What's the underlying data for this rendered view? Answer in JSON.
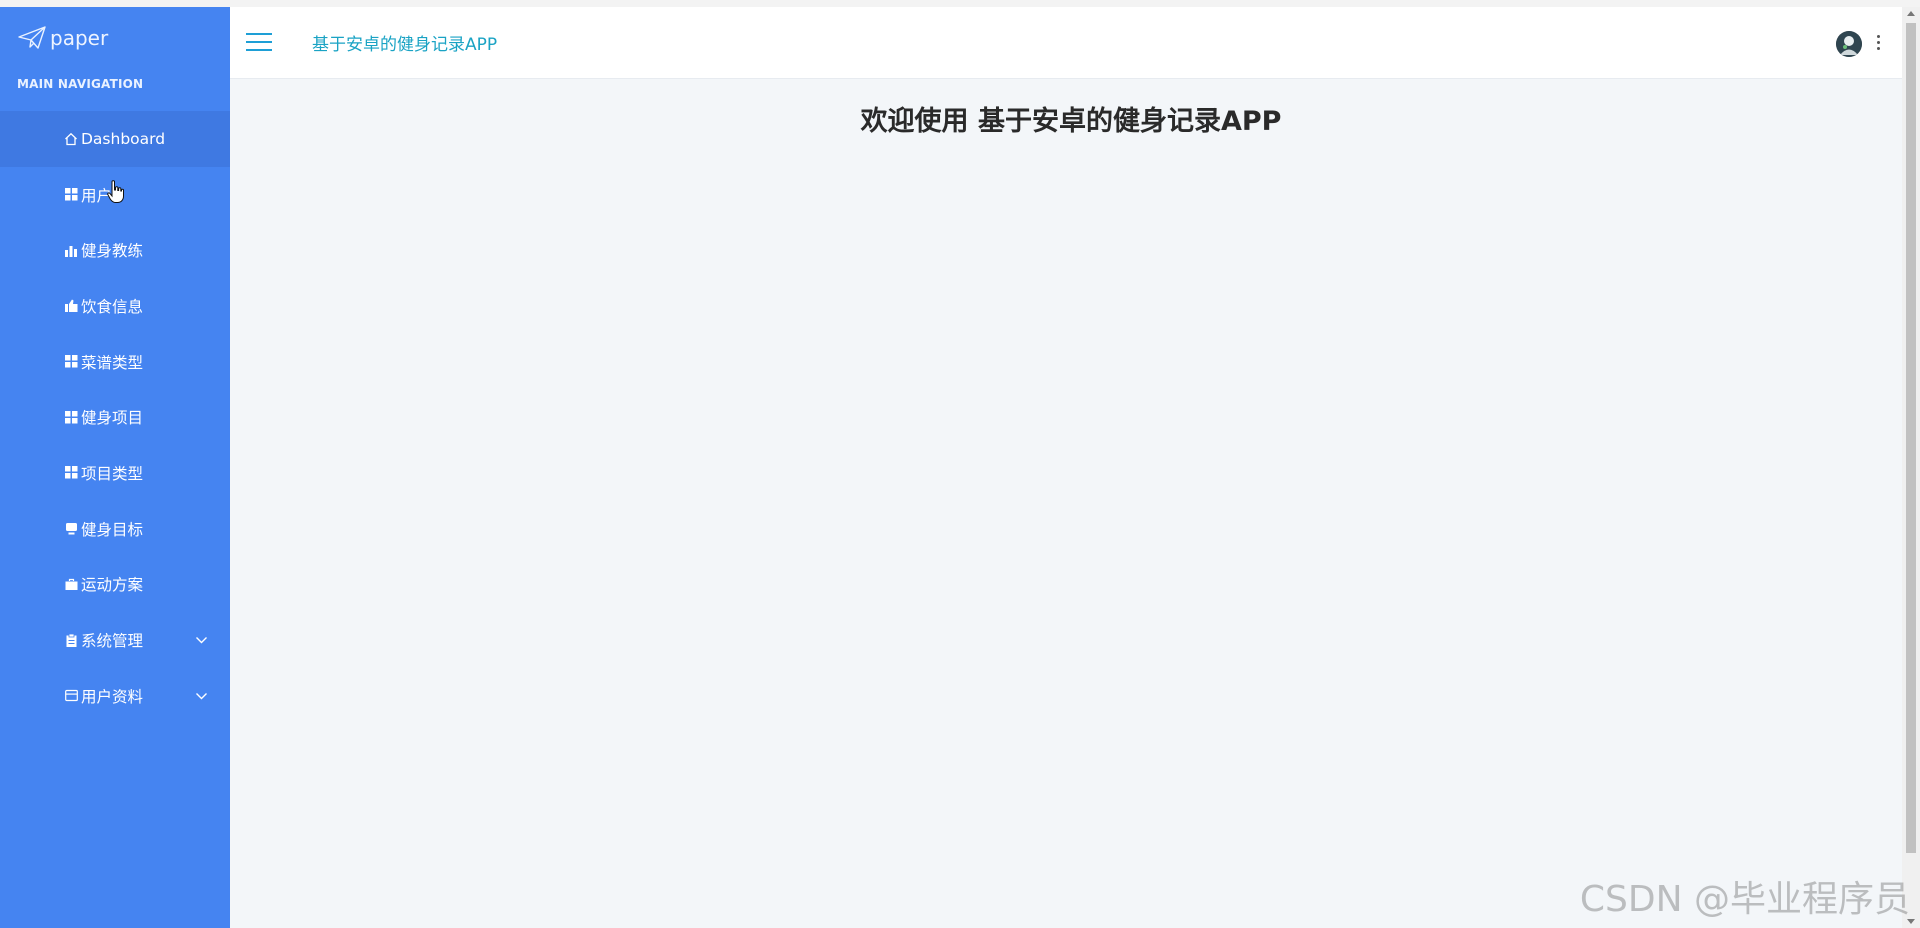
{
  "brand": {
    "logo_text": "paper"
  },
  "sidebar": {
    "heading": "MAIN NAVIGATION",
    "items": [
      {
        "label": "Dashboard",
        "icon": "home-icon"
      },
      {
        "label": "用户",
        "icon": "grid-icon"
      },
      {
        "label": "健身教练",
        "icon": "bar-chart-icon"
      },
      {
        "label": "饮食信息",
        "icon": "thumbs-up-icon"
      },
      {
        "label": "菜谱类型",
        "icon": "grid-icon"
      },
      {
        "label": "健身项目",
        "icon": "grid-icon"
      },
      {
        "label": "项目类型",
        "icon": "grid-icon"
      },
      {
        "label": "健身目标",
        "icon": "monitor-icon"
      },
      {
        "label": "运动方案",
        "icon": "briefcase-icon"
      },
      {
        "label": "系统管理",
        "icon": "clipboard-icon"
      },
      {
        "label": "用户资料",
        "icon": "id-card-icon"
      }
    ]
  },
  "header": {
    "app_title": "基于安卓的健身记录APP"
  },
  "main": {
    "welcome": "欢迎使用 基于安卓的健身记录APP"
  },
  "watermark": "CSDN @毕业程序员",
  "colors": {
    "sidebar": "#4584f1",
    "sidebar_active": "#3f79e2",
    "accent_title": "#1aa3c4",
    "main_bg": "#f3f6f9"
  }
}
